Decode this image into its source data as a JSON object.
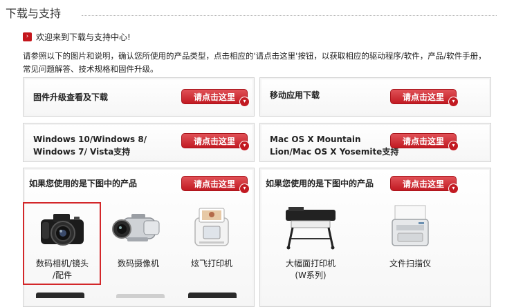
{
  "page": {
    "title": "下载与支持",
    "welcome": "欢迎来到下载与支持中心!",
    "intro": "请参照以下的图片和说明，确认您所使用的产品类型，点击相应的'请点击这里'按钮，以获取相应的驱动程序/软件，产品/软件手册，常见问题解答、技术规格和固件升级。"
  },
  "button_label": "请点击这里",
  "boxes": {
    "firmware": "固件升级查看及下载",
    "mobile": "移动应用下载",
    "windows_line1": "Windows 10/Windows 8/",
    "windows_line2": "Windows 7/ Vista支持",
    "mac_line1": "Mac OS X Mountain",
    "mac_line2": "Lion/Mac OS X Yosemite支持",
    "products_left": "如果您使用的是下图中的产品",
    "products_right": "如果您使用的是下图中的产品"
  },
  "products_left": [
    {
      "line1": "数码相机/镜头",
      "line2": "/配件"
    },
    {
      "line1": "数码摄像机",
      "line2": ""
    },
    {
      "line1": "炫飞打印机",
      "line2": ""
    }
  ],
  "products_right": [
    {
      "line1": "大幅面打印机",
      "line2": "(W系列)"
    },
    {
      "line1": "文件扫描仪",
      "line2": ""
    }
  ]
}
